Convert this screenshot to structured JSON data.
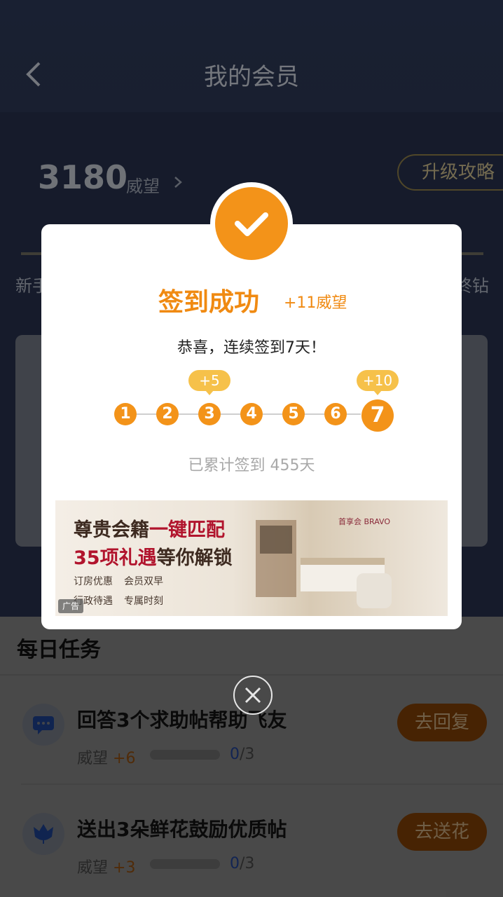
{
  "header": {
    "title": "我的会员",
    "points": "3180",
    "points_unit": "威望",
    "upgrade_label": "升级攻略",
    "level_left": "新手",
    "level_right": "终钻"
  },
  "tasks": {
    "section_title": "每日任务",
    "items": [
      {
        "title": "回答3个求助帖帮助飞友",
        "meta_label": "威望",
        "reward": "+6",
        "done": "0",
        "total": "/3",
        "button": "去回复"
      },
      {
        "title": "送出3朵鲜花鼓励优质帖",
        "meta_label": "威望",
        "reward": "+3",
        "done": "0",
        "total": "/3",
        "button": "去送花"
      }
    ]
  },
  "modal": {
    "title": "签到成功",
    "bonus": "+11威望",
    "congrats": "恭喜，连续签到7天！",
    "days": [
      "1",
      "2",
      "3",
      "4",
      "5",
      "6",
      "7"
    ],
    "bubbles": {
      "day3": "+5",
      "day7": "+10"
    },
    "total": "已累计签到 455天",
    "ad": {
      "line1_a": "尊贵会籍",
      "line1_b": "一键匹配",
      "line2_a": "35项礼遇",
      "line2_b": "等你解锁",
      "tags": [
        "订房优惠",
        "会员双早",
        "行政待遇",
        "专属时刻"
      ],
      "brand": "首享会 BRAVO",
      "badge": "广告"
    }
  },
  "colors": {
    "accent": "#f39319",
    "ad_red": "#b1142d"
  }
}
